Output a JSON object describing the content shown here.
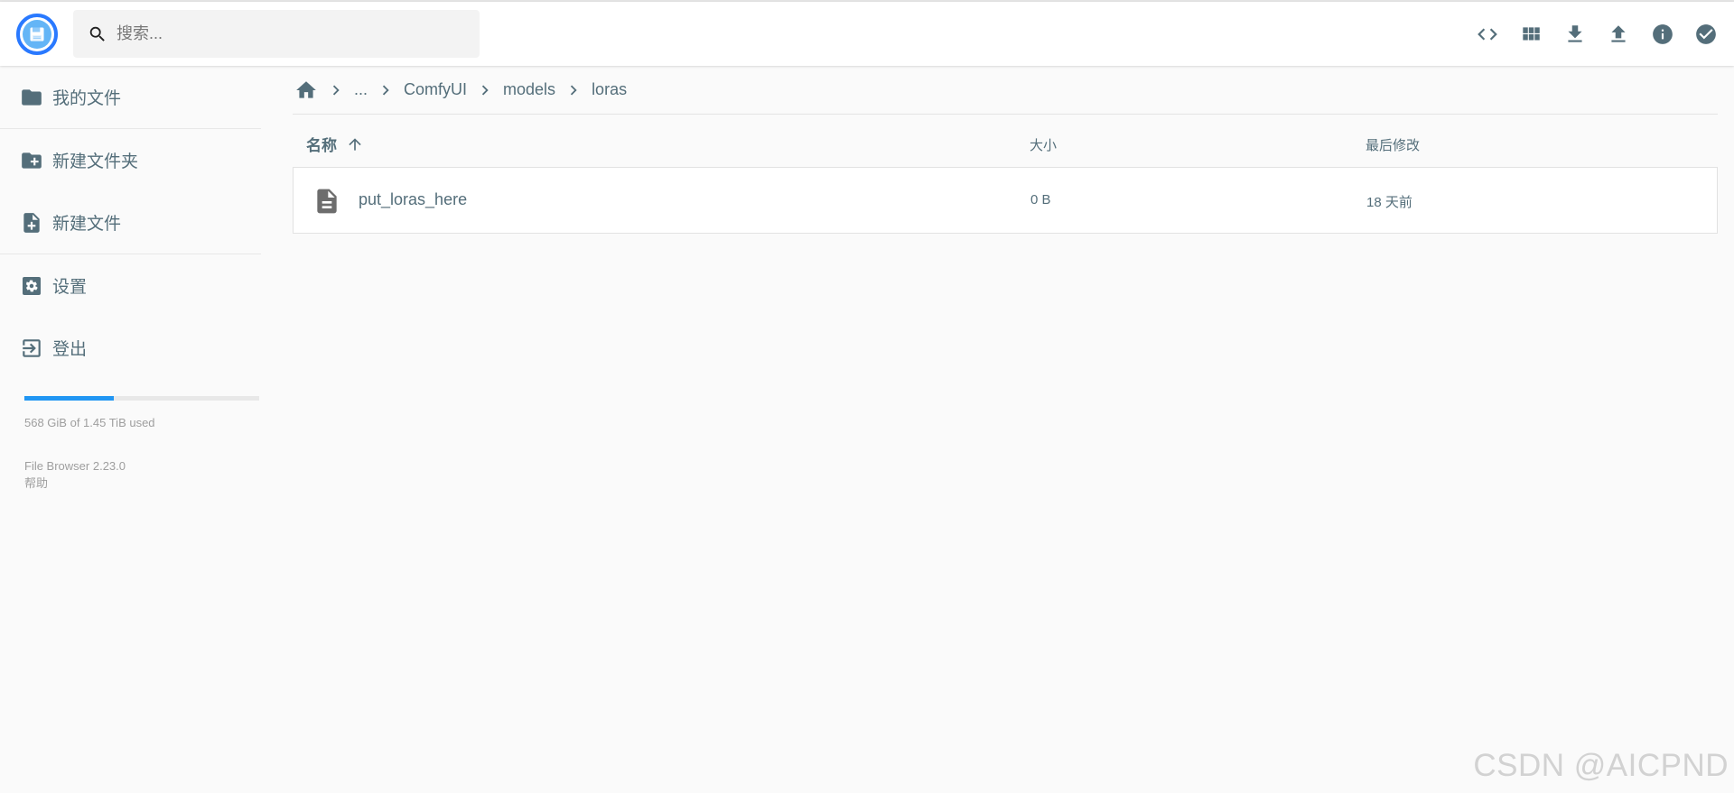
{
  "search": {
    "placeholder": "搜索..."
  },
  "header_actions": [
    {
      "icon": "code-icon"
    },
    {
      "icon": "grid-view-icon"
    },
    {
      "icon": "download-icon"
    },
    {
      "icon": "upload-icon"
    },
    {
      "icon": "info-icon"
    },
    {
      "icon": "check-circle-icon"
    }
  ],
  "sidebar": {
    "items": [
      {
        "label": "我的文件",
        "icon": "folder-icon"
      },
      {
        "label": "新建文件夹",
        "icon": "new-folder-icon"
      },
      {
        "label": "新建文件",
        "icon": "new-file-icon"
      },
      {
        "label": "设置",
        "icon": "settings-icon"
      },
      {
        "label": "登出",
        "icon": "logout-icon"
      }
    ],
    "usage": {
      "text": "568 GiB of 1.45 TiB used",
      "fraction": 0.38
    },
    "credits": {
      "version": "File Browser 2.23.0",
      "help": "帮助"
    }
  },
  "breadcrumbs": {
    "items": [
      "...",
      "ComfyUI",
      "models",
      "loras"
    ]
  },
  "listing": {
    "columns": {
      "name": "名称",
      "size": "大小",
      "modified": "最后修改"
    },
    "sort": "ascending",
    "rows": [
      {
        "name": "put_loras_here",
        "size": "0 B",
        "modified": "18 天前",
        "icon": "file-icon"
      }
    ]
  },
  "watermark": "CSDN @AICPND",
  "colors": {
    "icon": "#546e7a",
    "accent": "#2196f3",
    "logo_ring": "#2979ff",
    "file_icon": "#6d6d6d"
  }
}
